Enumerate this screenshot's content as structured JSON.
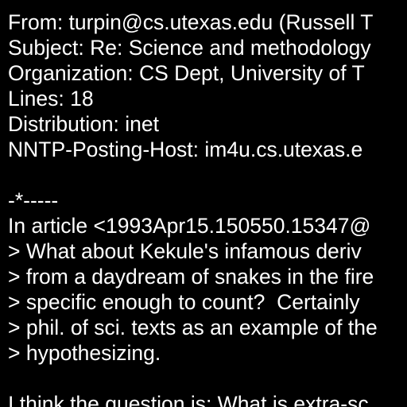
{
  "colors": {
    "background": "#000000",
    "text": "#ffffff"
  },
  "header": {
    "from": "From: turpin@cs.utexas.edu (Russell T",
    "subject": "Subject: Re: Science and methodology",
    "organization": "Organization: CS Dept, University of T",
    "lines": "Lines: 18",
    "distribution": "Distribution: inet",
    "nntp_host": "NNTP-Posting-Host: im4u.cs.utexas.e"
  },
  "body": {
    "separator": "-*-----",
    "attribution": "In article <1993Apr15.150550.15347@",
    "quoted": [
      "> What about Kekule's infamous deriv",
      "> from a daydream of snakes in the fire",
      "> specific enough to count?  Certainly",
      "> phil. of sci. texts as an example of the",
      "> hypothesizing."
    ],
    "reply": "I think the question is: What is extra-sc"
  }
}
